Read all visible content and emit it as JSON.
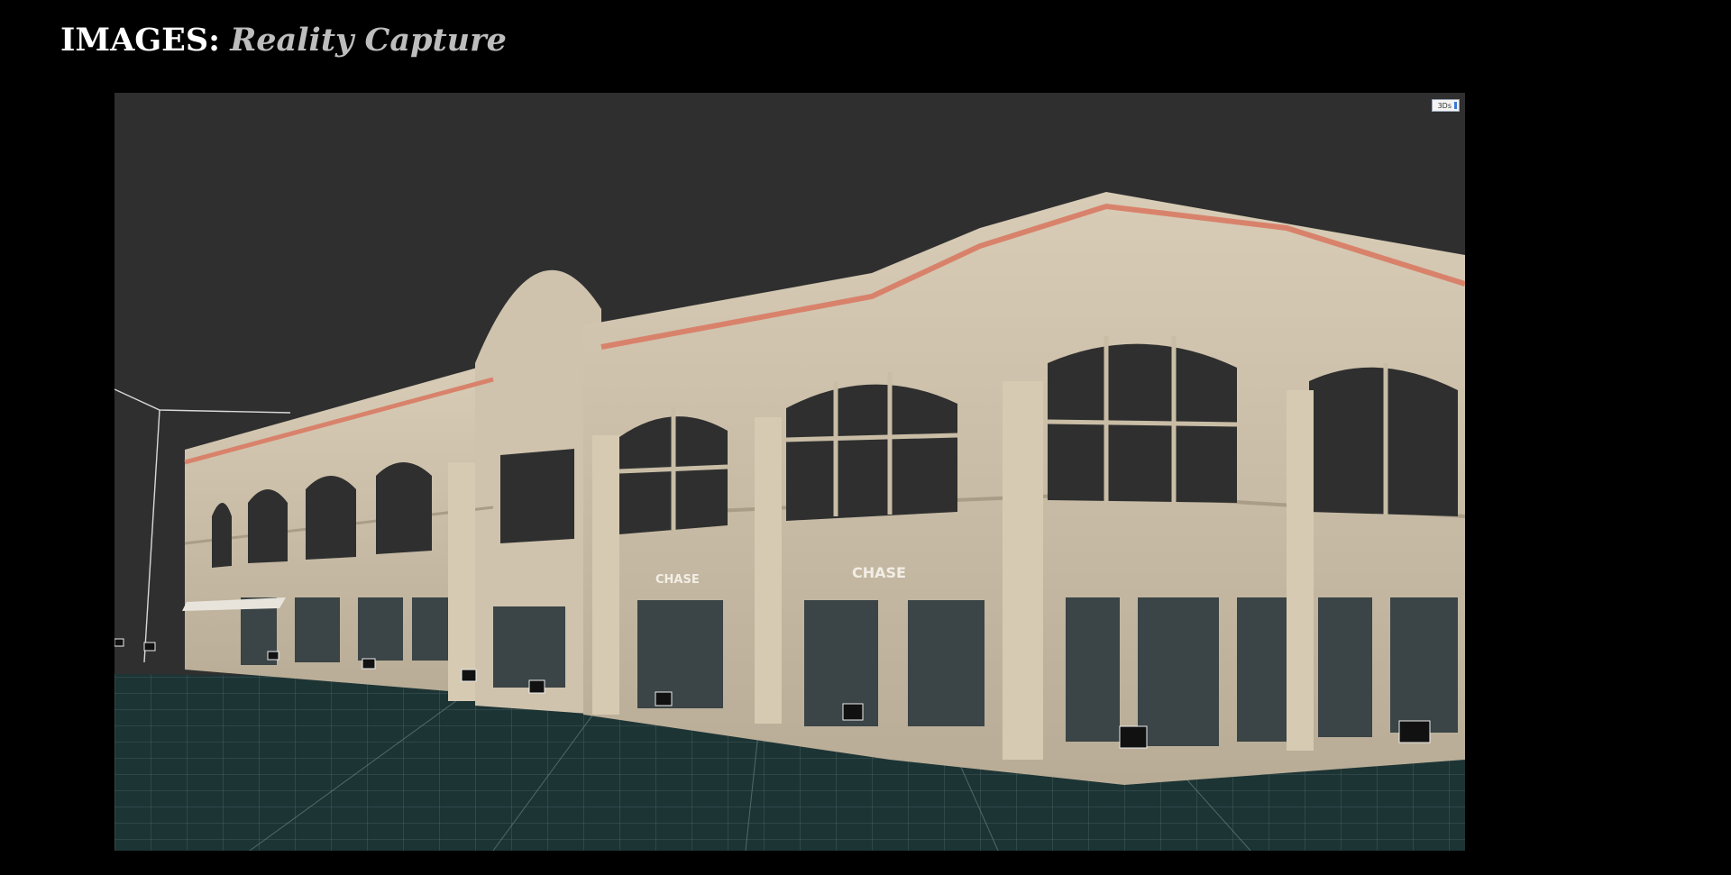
{
  "header": {
    "prefix": "IMAGES:",
    "suffix": "Reality Capture"
  },
  "viewport": {
    "view_badge": "3Ds",
    "signs": [
      "CHASE",
      "CHASE"
    ],
    "colors": {
      "background": "#2f2f2f",
      "ground": "#1d3435",
      "grid": "#6f8c8c",
      "facade": "#c9bda6",
      "cornice_accent": "#d9826b"
    }
  }
}
